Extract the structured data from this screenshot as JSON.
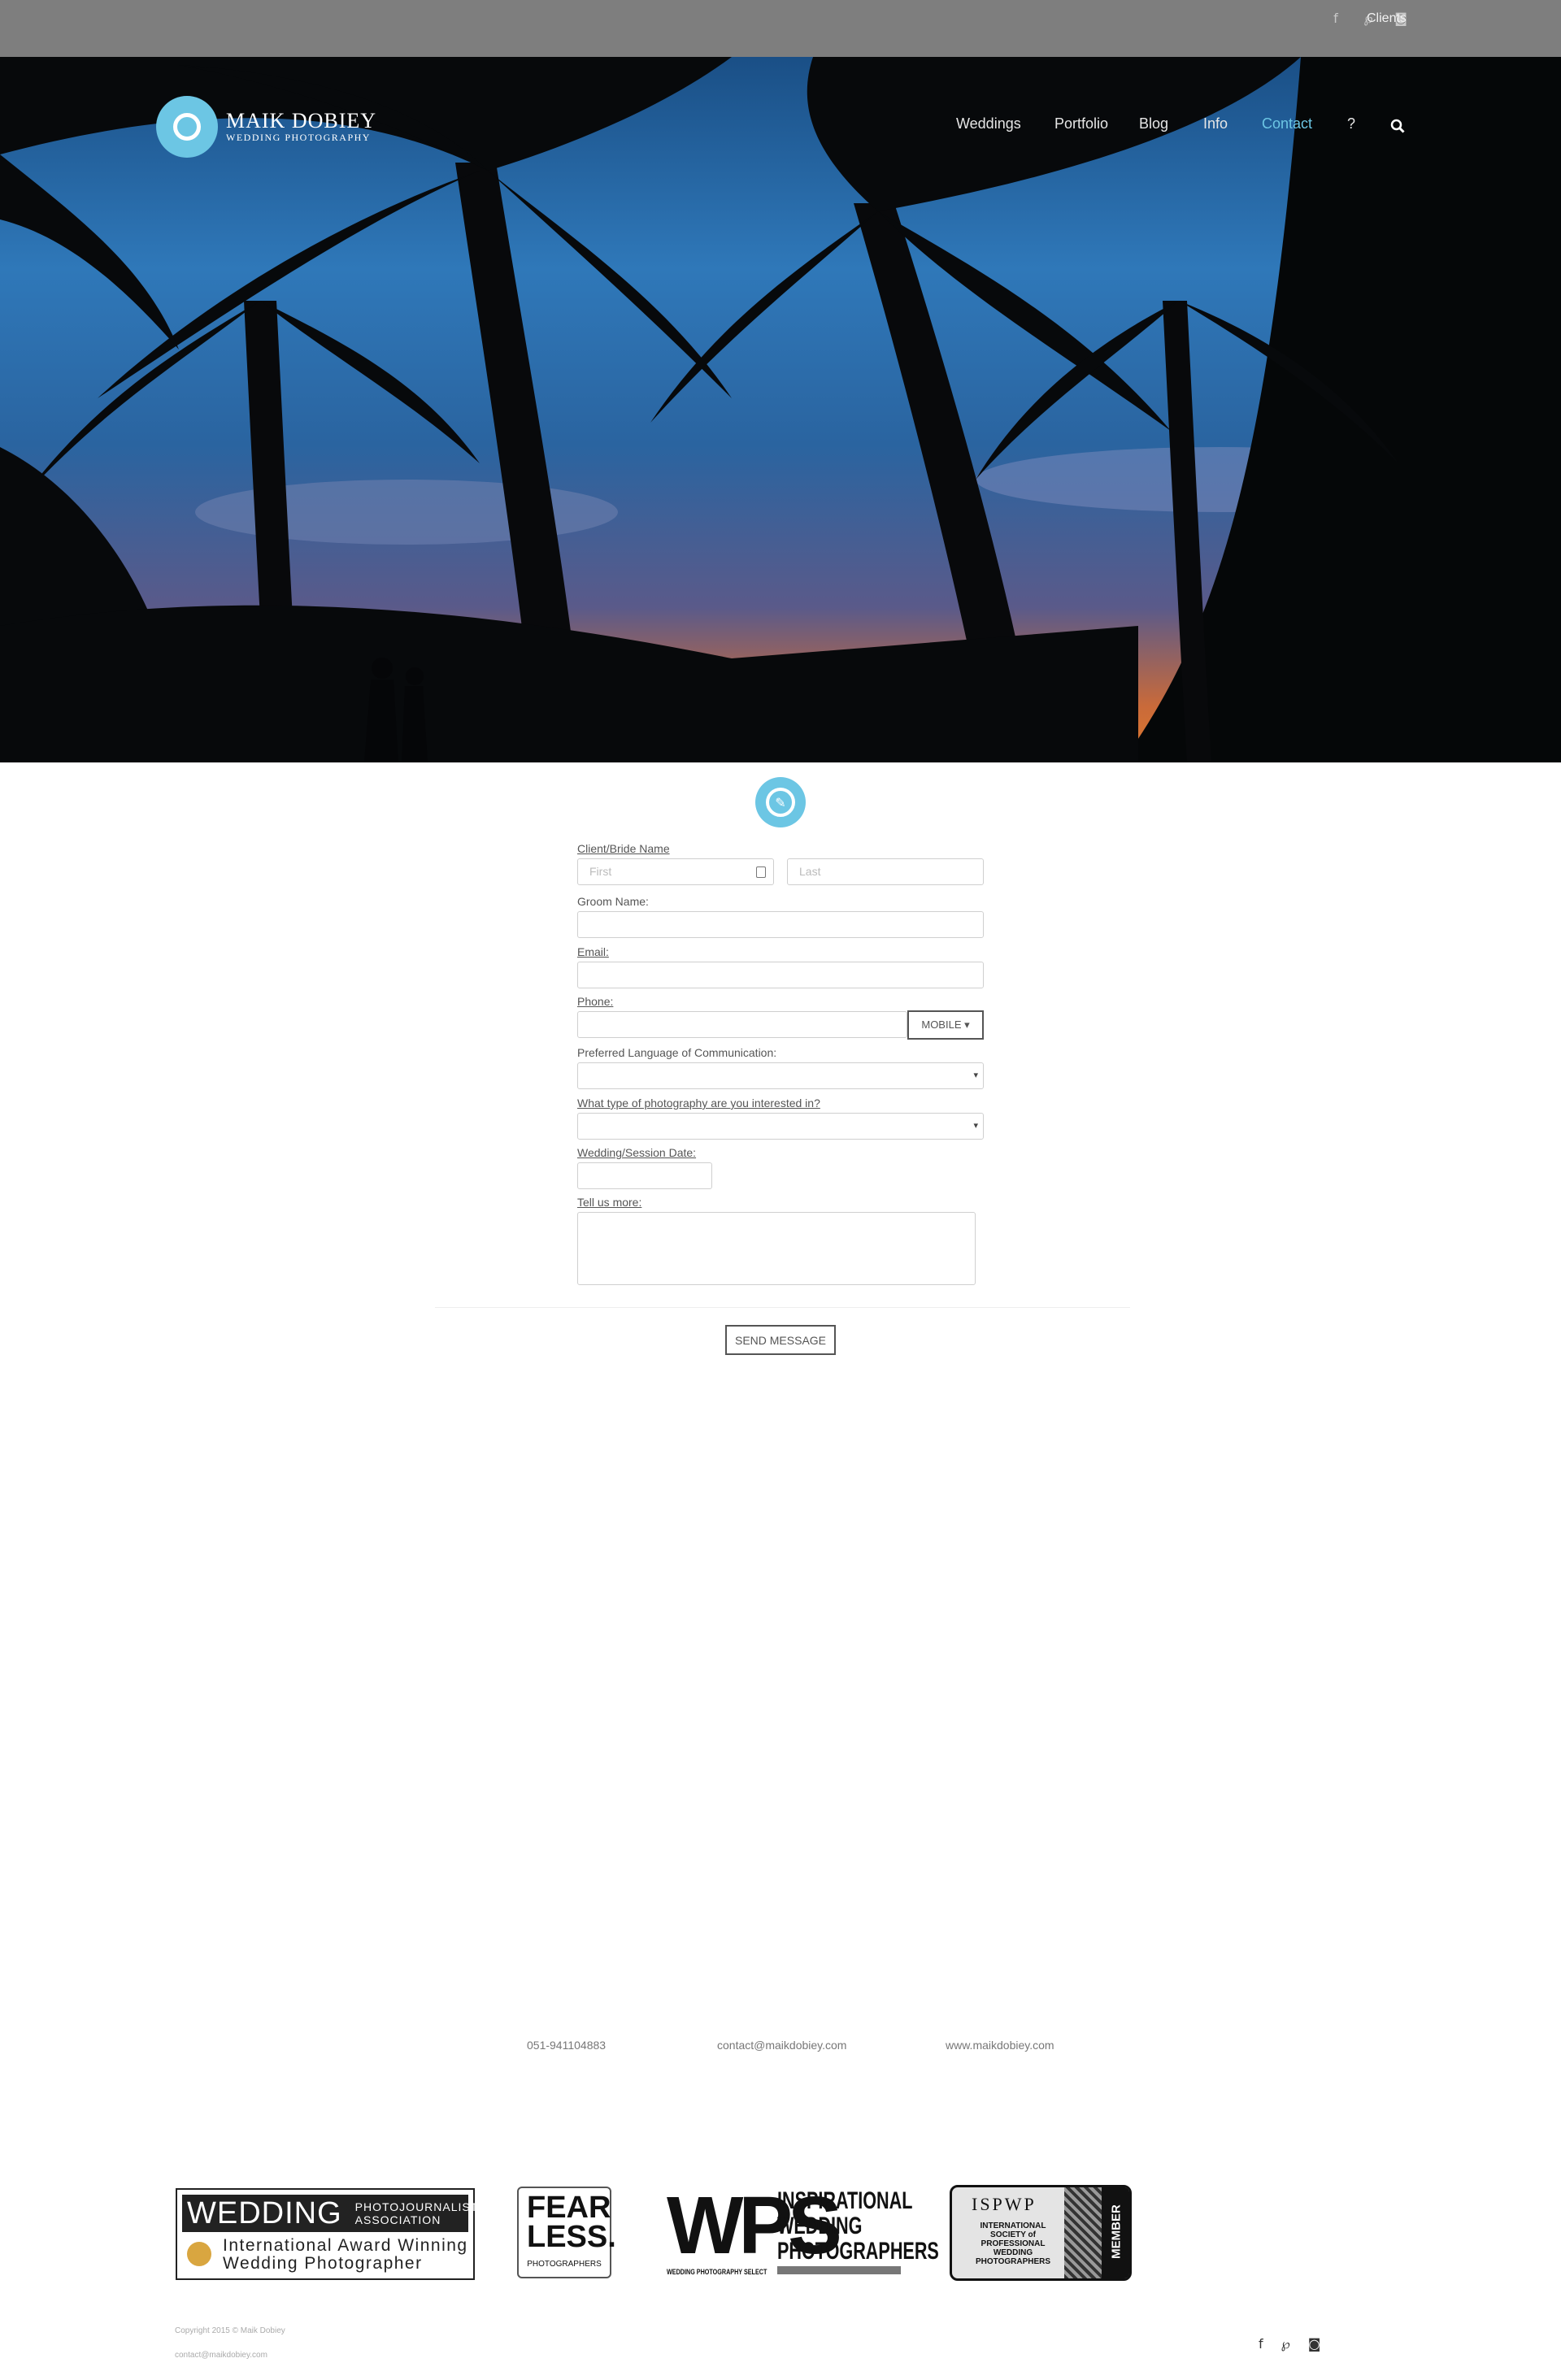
{
  "topbar": {
    "social": [
      {
        "icon": "facebook-icon",
        "glyph": "f"
      },
      {
        "icon": "pinterest-icon",
        "glyph": "℘"
      },
      {
        "icon": "instagram-icon",
        "glyph": "◙"
      }
    ],
    "clients_label": "Clients"
  },
  "logo": {
    "name": "MAIK DOBIEY",
    "tagline": "WEDDING PHOTOGRAPHY"
  },
  "nav": {
    "items": [
      "Weddings",
      "Portfolio",
      "Blog",
      "Info",
      "Contact",
      "?"
    ],
    "active": "Contact"
  },
  "form": {
    "client_label": "Client/Bride Name",
    "first_placeholder": "First",
    "last_placeholder": "Last",
    "groom_label": "Groom Name:",
    "email_label": "Email:",
    "phone_label": "Phone:",
    "phone_type": "MOBILE ▾",
    "language_label": "Preferred Language of Communication:",
    "type_label": "What type of photography are you interested in?",
    "date_label": "Wedding/Session Date:",
    "more_label": "Tell us more:",
    "send_label": "SEND MESSAGE"
  },
  "contact": {
    "phone": "051-941104883",
    "email": "contact@maikdobiey.com",
    "website": "www.maikdobiey.com"
  },
  "badges": {
    "wpja": {
      "title": "WEDDING",
      "org1": "PHOTOJOURNALIST",
      "org2": "ASSOCIATION",
      "line1": "International Award Winning",
      "line2": "Wedding Photographer"
    },
    "fearless": {
      "line1": "FEAR",
      "line2": "LESS.",
      "sub": "PHOTOGRAPHERS"
    },
    "wps": {
      "mark": "WPS",
      "line1": "INSPIRATIONAL",
      "line2": "WEDDING",
      "line3": "PHOTOGRAPHERS",
      "sub": "WEDDING PHOTOGRAPHY SELECT"
    },
    "ispwp": {
      "title": "ISPWP",
      "l1": "INTERNATIONAL",
      "l2": "SOCIETY of",
      "l3": "PROFESSIONAL",
      "l4": "WEDDING",
      "l5": "PHOTOGRAPHERS",
      "member": "MEMBER"
    }
  },
  "footer": {
    "copyright": "Copyright 2015 © Maik Dobiey",
    "email": "contact@maikdobiey.com",
    "social": [
      {
        "icon": "facebook-icon",
        "glyph": "f"
      },
      {
        "icon": "pinterest-icon",
        "glyph": "℘"
      },
      {
        "icon": "instagram-icon",
        "glyph": "◙"
      }
    ]
  },
  "colors": {
    "accent": "#6cc6e4",
    "topbar": "#7e7e7e"
  }
}
